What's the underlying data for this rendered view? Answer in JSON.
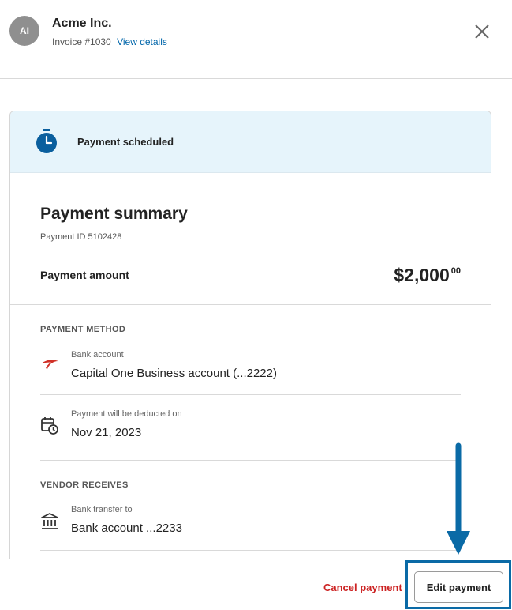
{
  "header": {
    "avatar_initials": "AI",
    "company": "Acme Inc.",
    "invoice_number": "Invoice #1030",
    "view_details_link": "View details"
  },
  "banner": {
    "icon": "timer-icon",
    "text": "Payment scheduled"
  },
  "summary": {
    "title": "Payment summary",
    "payment_id": "Payment ID 5102428",
    "amount_label": "Payment amount",
    "amount_main": "$2,000",
    "amount_cents": "00"
  },
  "payment_method": {
    "section_label": "PAYMENT METHOD",
    "bank_caption": "Bank account",
    "bank_value": "Capital One Business account (...2222)",
    "deduct_caption": "Payment will be deducted on",
    "deduct_value": "Nov 21, 2023"
  },
  "vendor": {
    "section_label": "VENDOR RECEIVES",
    "transfer_caption": "Bank transfer to",
    "transfer_value": "Bank account ...2233"
  },
  "footer": {
    "cancel_label": "Cancel payment",
    "edit_label": "Edit payment"
  },
  "colors": {
    "banner_bg": "#e6f4fb",
    "link": "#0066aa",
    "cancel": "#cc2222",
    "annotation": "#0a6aa6",
    "brand_swoosh": "#d03027"
  }
}
